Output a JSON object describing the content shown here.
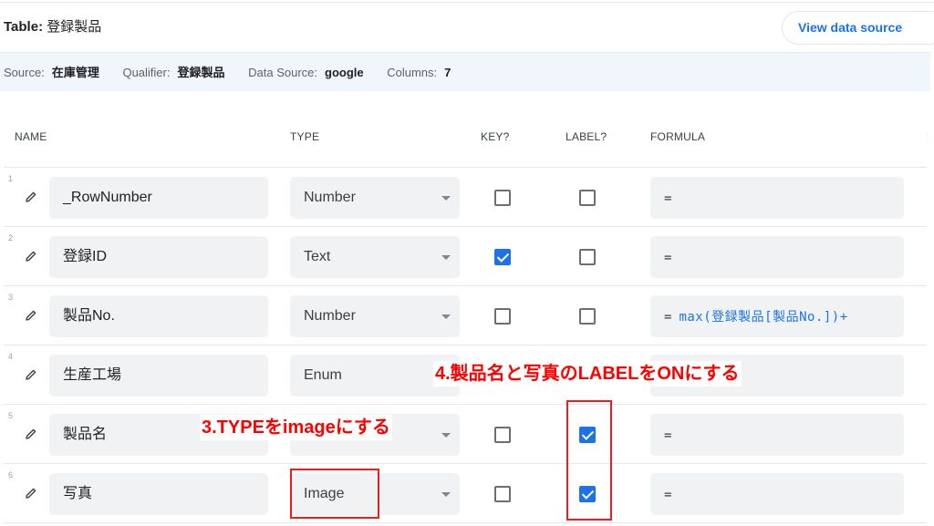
{
  "header": {
    "table_label": "Table:",
    "table_name": "登録製品",
    "view_data_source_label": "View data source"
  },
  "infobar": {
    "source_key": "Source:",
    "source_value": "在庫管理",
    "qualifier_key": "Qualifier:",
    "qualifier_value": "登録製品",
    "data_source_key": "Data Source:",
    "data_source_value": "google",
    "columns_key": "Columns:",
    "columns_value": "7"
  },
  "columns": {
    "name": "NAME",
    "type": "TYPE",
    "key": "KEY?",
    "label": "LABEL?",
    "formula": "FORMULA"
  },
  "rows": [
    {
      "num": "1",
      "name": "_RowNumber",
      "type": "Number",
      "key": false,
      "label": false,
      "formula_eq": "=",
      "formula_expr": ""
    },
    {
      "num": "2",
      "name": "登録ID",
      "type": "Text",
      "key": true,
      "label": false,
      "formula_eq": "=",
      "formula_expr": ""
    },
    {
      "num": "3",
      "name": "製品No.",
      "type": "Number",
      "key": false,
      "label": false,
      "formula_eq": "=",
      "formula_expr": "max(登録製品[製品No.])+"
    },
    {
      "num": "4",
      "name": "生産工場",
      "type": "Enum",
      "key": false,
      "label": false,
      "formula_eq": "",
      "formula_expr": ""
    },
    {
      "num": "5",
      "name": "製品名",
      "type": "",
      "key": false,
      "label": true,
      "formula_eq": "=",
      "formula_expr": ""
    },
    {
      "num": "6",
      "name": "写真",
      "type": "Image",
      "key": false,
      "label": true,
      "formula_eq": "=",
      "formula_expr": ""
    }
  ],
  "annotations": {
    "step3": "3.TYPEをimageにする",
    "step4": "4.製品名と写真のLABELをONにする",
    "highlight_color": "#ff0000"
  },
  "colors": {
    "accent": "#1a73e8",
    "infobar_bg": "#f1f5fc",
    "field_bg": "#f1f2f4"
  }
}
